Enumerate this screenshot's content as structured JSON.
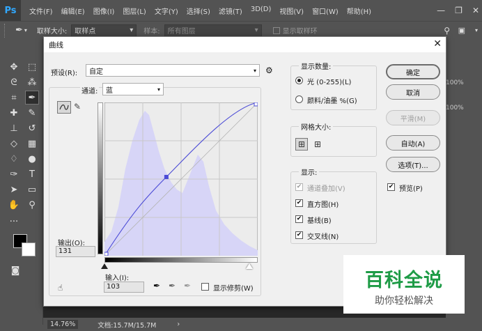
{
  "app": {
    "logo": "Ps"
  },
  "menu": [
    "文件(F)",
    "编辑(E)",
    "图像(I)",
    "图层(L)",
    "文字(Y)",
    "选择(S)",
    "滤镜(T)",
    "3D(D)",
    "视图(V)",
    "窗口(W)",
    "帮助(H)"
  ],
  "window_controls": {
    "minimize": "—",
    "restore": "❐",
    "close": "✕"
  },
  "options": {
    "sample_size_label": "取样大小:",
    "sample_size_value": "取样点",
    "sample_label": "样本:",
    "sample_value": "所有图层",
    "show_ring_label": "显示取样环"
  },
  "panel_right": {
    "pct1": "100%",
    "pct2": "100%"
  },
  "status": {
    "zoom": "14.76%",
    "doc": "文档:15.7M/15.7M"
  },
  "dialog": {
    "title": "曲线",
    "close": "✕",
    "preset_label": "预设(R):",
    "preset_value": "自定",
    "channel_label": "通道:",
    "channel_value": "蓝",
    "output_label": "输出(O):",
    "output_value": "131",
    "input_label": "输入(I):",
    "input_value": "103",
    "show_clipping_label": "显示修剪(W)",
    "show_amount": {
      "title": "显示数量:",
      "light": "光 (0-255)(L)",
      "pigment": "颜料/油墨 %(G)",
      "selected": "light"
    },
    "grid_size": {
      "title": "网格大小:"
    },
    "display": {
      "title": "显示:",
      "items": [
        {
          "label": "通道叠加(V)",
          "checked": true,
          "disabled": true
        },
        {
          "label": "直方图(H)",
          "checked": true,
          "disabled": false
        },
        {
          "label": "基线(B)",
          "checked": true,
          "disabled": false
        },
        {
          "label": "交叉线(N)",
          "checked": true,
          "disabled": false
        }
      ]
    },
    "buttons": {
      "ok": "确定",
      "cancel": "取消",
      "smooth": "平滑(M)",
      "auto": "自动(A)",
      "options": "选项(T)..."
    },
    "preview_label": "预览(P)",
    "curve": {
      "channel_color": "#4b4bd6",
      "histogram_color": "#d7d5f7",
      "point_in": 103,
      "point_out": 131
    }
  },
  "watermark": {
    "title": "百科全说",
    "subtitle": "助你轻松解决",
    "color": "#1e9b46"
  }
}
